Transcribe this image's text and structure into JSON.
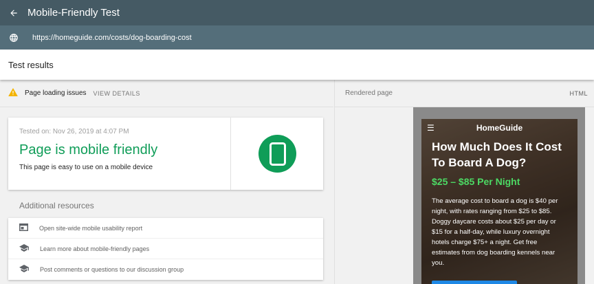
{
  "app": {
    "title": "Mobile-Friendly Test"
  },
  "url_bar": {
    "url": "https://homeguide.com/costs/dog-boarding-cost"
  },
  "results": {
    "title": "Test results"
  },
  "issues": {
    "label": "Page loading issues",
    "action": "VIEW DETAILS"
  },
  "result_card": {
    "tested_on": "Tested on: Nov 26, 2019 at 4:07 PM",
    "verdict": "Page is mobile friendly",
    "subtitle": "This page is easy to use on a mobile device"
  },
  "additional": {
    "title": "Additional resources",
    "items": [
      {
        "icon": "window-icon",
        "label": "Open site-wide mobile usability report"
      },
      {
        "icon": "school-icon",
        "label": "Learn more about mobile-friendly pages"
      },
      {
        "icon": "school-icon",
        "label": "Post comments or questions to our discussion group"
      }
    ]
  },
  "rendered": {
    "label": "Rendered page",
    "html_tab": "HTML"
  },
  "preview": {
    "logo": "HomeGuide",
    "title": "How Much Does It Cost To Board A Dog?",
    "price": "$25 – $85 Per Night",
    "description": "The average cost to board a dog is $40 per night, with rates ranging from $25 to $85. Doggy daycare costs about $25 per day or $15 for a half-day, while luxury overnight hotels charge $75+ a night. Get free estimates from dog boarding kennels near you."
  },
  "colors": {
    "header": "#455a64",
    "url_bar": "#546e7a",
    "success": "#0f9d58",
    "warning": "#f4b400",
    "price": "#4cd964"
  }
}
